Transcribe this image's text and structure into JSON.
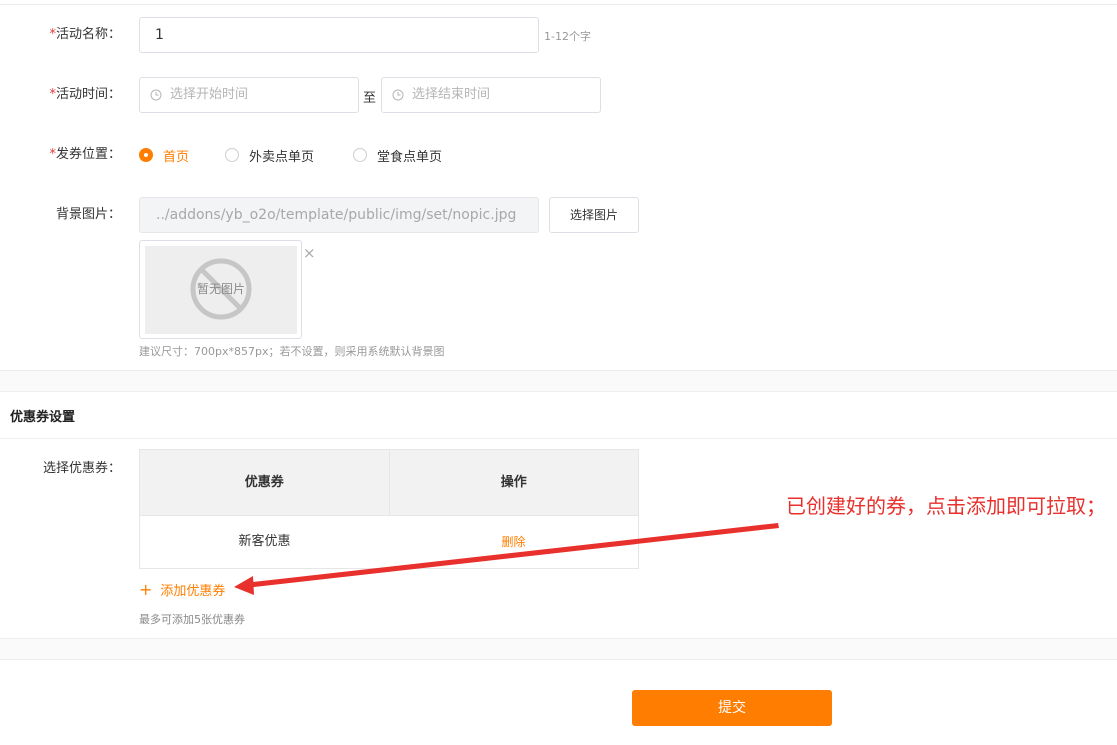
{
  "form": {
    "activity_name": {
      "label": "活动名称：",
      "required_mark": "*",
      "value": "1",
      "hint": "1-12个字"
    },
    "activity_time": {
      "label": "活动时间：",
      "required_mark": "*",
      "start_placeholder": "选择开始时间",
      "separator": "至",
      "end_placeholder": "选择结束时间"
    },
    "coupon_position": {
      "label": "发券位置：",
      "required_mark": "*",
      "options": [
        {
          "label": "首页",
          "selected": true
        },
        {
          "label": "外卖点单页",
          "selected": false
        },
        {
          "label": "堂食点单页",
          "selected": false
        }
      ]
    },
    "background_image": {
      "label": "背景图片：",
      "path": "../addons/yb_o2o/template/public/img/set/nopic.jpg",
      "choose_button": "选择图片",
      "preview_text": "暂无图片",
      "close_symbol": "×",
      "size_hint": "建议尺寸：700px*857px；若不设置，则采用系统默认背景图"
    }
  },
  "coupon_section": {
    "title": "优惠券设置",
    "select_label": "选择优惠券：",
    "table": {
      "headers": [
        "优惠券",
        "操作"
      ],
      "rows": [
        {
          "name": "新客优惠",
          "action": "删除"
        }
      ]
    },
    "add_icon": "+",
    "add_label": "添加优惠券",
    "max_hint": "最多可添加5张优惠券"
  },
  "annotation": "已创建好的券，点击添加即可拉取；",
  "submit_label": "提交",
  "colors": {
    "accent": "#ff7d00",
    "annotation": "#e8302d",
    "required": "#e4393c"
  }
}
